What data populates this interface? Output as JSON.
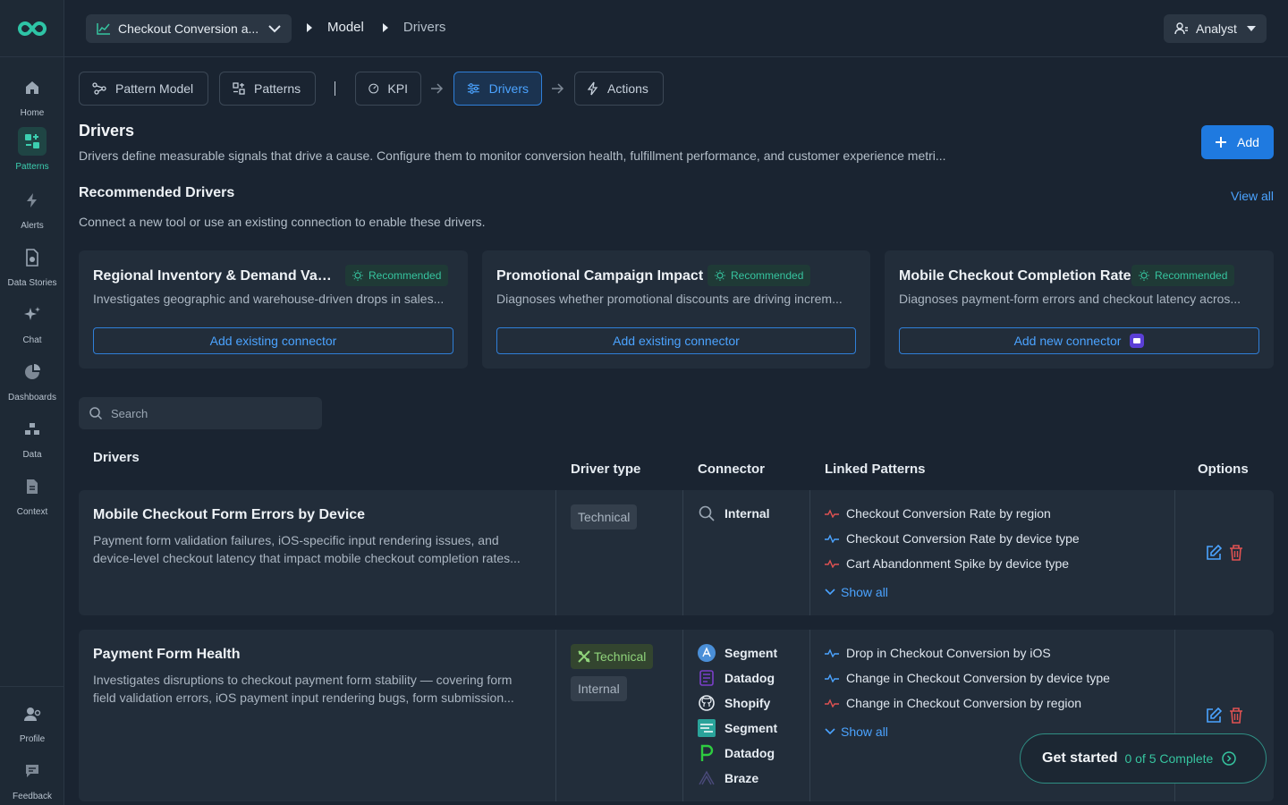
{
  "app": {
    "name": "Patterns"
  },
  "sidebar": {
    "items": [
      {
        "label": "Home",
        "icon": "home-icon"
      },
      {
        "label": "Patterns",
        "icon": "patterns-icon",
        "active": true
      },
      {
        "label": "Alerts",
        "icon": "bolt-icon"
      },
      {
        "label": "Data Stories",
        "icon": "data-stories-icon"
      },
      {
        "label": "Chat",
        "icon": "sparkle-icon"
      },
      {
        "label": "Dashboards",
        "icon": "pie-chart-icon"
      },
      {
        "label": "Data",
        "icon": "data-icon"
      },
      {
        "label": "Context",
        "icon": "document-icon"
      }
    ],
    "bottom": [
      {
        "label": "Profile",
        "icon": "profile-icon"
      },
      {
        "label": "Feedback",
        "icon": "feedback-icon"
      }
    ]
  },
  "topbar": {
    "kpi_select": "Checkout Conversion a...",
    "breadcrumb": [
      "Model",
      "Drivers"
    ],
    "role": "Analyst"
  },
  "tabs": [
    {
      "label": "Pattern Model"
    },
    {
      "label": "Patterns"
    },
    {
      "label": "KPI"
    },
    {
      "label": "Drivers",
      "active": true
    },
    {
      "label": "Actions"
    }
  ],
  "page": {
    "title": "Drivers",
    "description": "Drivers define measurable signals that drive a cause. Configure them to monitor conversion health, fulfillment performance, and customer experience metri...",
    "add_label": "Add"
  },
  "recommended": {
    "title": "Recommended Drivers",
    "view_all": "View all",
    "subtitle": "Connect a new tool or use an existing connection to enable these drivers.",
    "badge": "Recommended",
    "cards": [
      {
        "title": "Regional Inventory & Demand Vari...",
        "description": "Investigates geographic and warehouse-driven drops in sales...",
        "action": "Add existing connector"
      },
      {
        "title": "Promotional Campaign Impact",
        "description": "Diagnoses whether promotional discounts are driving increm...",
        "action": "Add existing connector"
      },
      {
        "title": "Mobile Checkout Completion Rate",
        "description": "Diagnoses payment-form errors and checkout latency acros...",
        "action": "Add new connector"
      }
    ]
  },
  "search": {
    "placeholder": "Search"
  },
  "table": {
    "headers": {
      "drivers": "Drivers",
      "type": "Driver type",
      "connector": "Connector",
      "patterns": "Linked Patterns",
      "options": "Options"
    },
    "show_all": "Show all",
    "rows": [
      {
        "name": "Mobile Checkout Form Errors by Device",
        "description": "Payment form validation failures, iOS-specific input rendering issues, and device-level checkout latency that impact mobile checkout completion rates...",
        "types": [
          "Technical"
        ],
        "connectors": [
          "Internal"
        ],
        "patterns": [
          "Checkout Conversion Rate by region",
          "Checkout Conversion Rate by device type",
          "Cart Abandonment Spike by device type"
        ]
      },
      {
        "name": "Payment Form Health",
        "description": "Investigates disruptions to checkout payment form stability — covering form field validation errors, iOS payment input rendering bugs, form submission...",
        "types": [
          "Technical",
          "Internal"
        ],
        "connectors": [
          "Segment",
          "Datadog",
          "Shopify",
          "Segment",
          "Datadog",
          "Braze"
        ],
        "patterns": [
          "Drop in Checkout Conversion by iOS",
          "Change in Checkout Conversion by device type",
          "Change in Checkout Conversion by region"
        ]
      }
    ]
  },
  "get_started": {
    "label": "Get started",
    "progress": "0 of 5 Complete"
  },
  "colors": {
    "accent": "#1f7ae0",
    "teal": "#36c49f",
    "danger": "#e05252",
    "bg": "#1a2431"
  }
}
